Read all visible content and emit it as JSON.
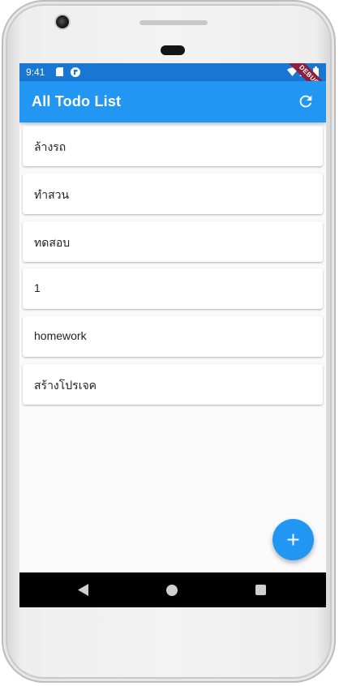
{
  "status_bar": {
    "time": "9:41",
    "icons": [
      "sd-card-icon",
      "app-notification-icon",
      "wifi-icon",
      "signal-icon",
      "battery-icon"
    ],
    "debug_banner": "DEBUG"
  },
  "app_bar": {
    "title": "All Todo List",
    "action_icon": "refresh-icon",
    "color": "#2196f3",
    "status_color": "#1976d2"
  },
  "todos": [
    {
      "label": "ล้างรถ"
    },
    {
      "label": "ทำสวน"
    },
    {
      "label": "ทดสอบ"
    },
    {
      "label": "1"
    },
    {
      "label": "homework"
    },
    {
      "label": "สร้างโปรเจค"
    }
  ],
  "fab": {
    "icon": "plus-icon",
    "color": "#2196f3"
  },
  "nav_bar": {
    "icons": [
      "back-icon",
      "home-icon",
      "recents-icon"
    ]
  }
}
